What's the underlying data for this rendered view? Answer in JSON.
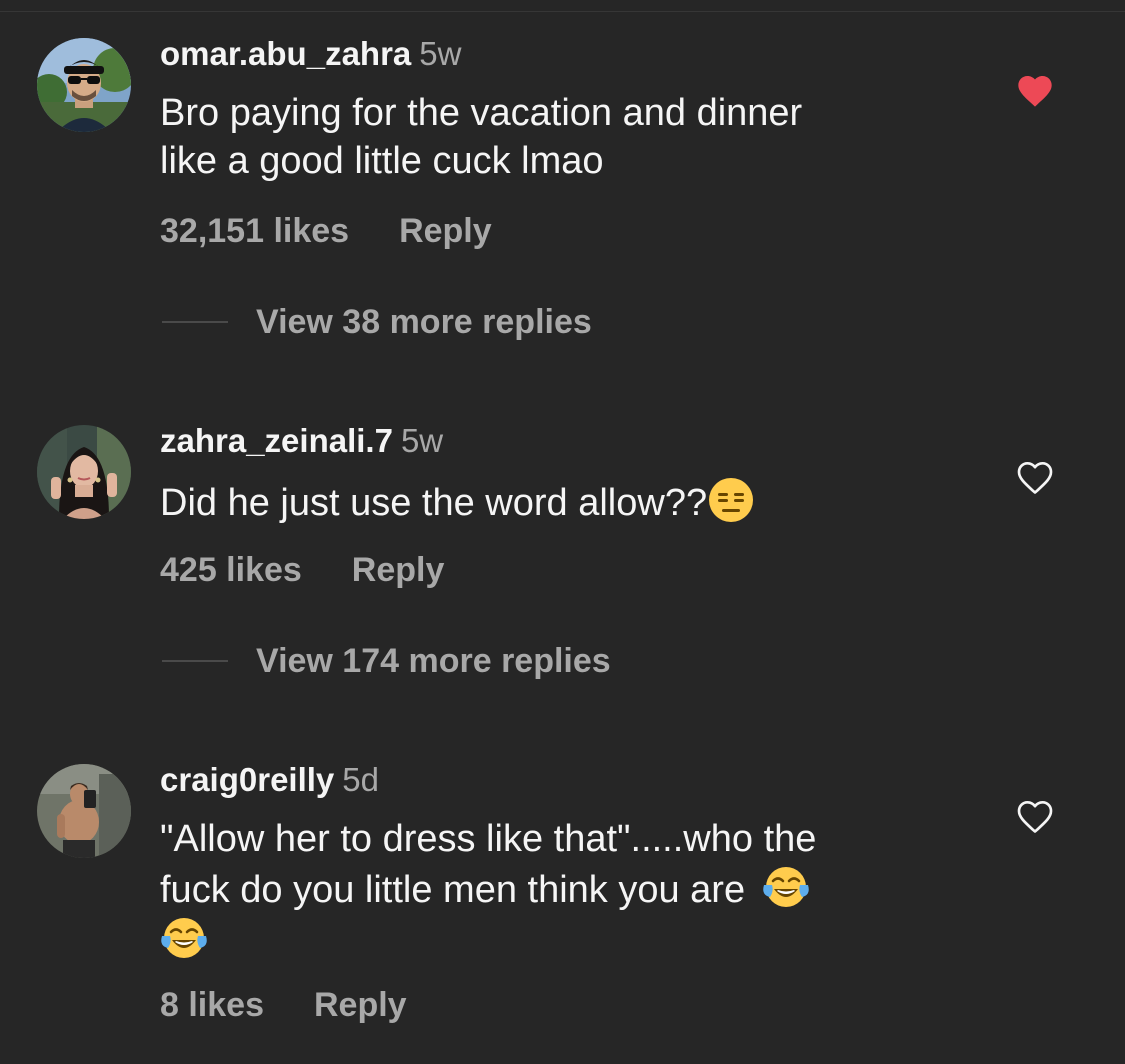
{
  "colors": {
    "background": "#262626",
    "text_primary": "#f5f5f5",
    "text_secondary": "#a8a8a8",
    "liked_heart": "#ed4956"
  },
  "comments": [
    {
      "username": "omar.abu_zahra",
      "time": "5w",
      "text_lines": [
        "Bro paying for the vacation and dinner",
        "like a good little cuck lmao"
      ],
      "emojis": [],
      "likes": "32,151 likes",
      "reply_label": "Reply",
      "view_replies": "View 38 more replies",
      "liked": true,
      "heart_icon": "heart-filled-icon"
    },
    {
      "username": "zahra_zeinali.7",
      "time": "5w",
      "text_lines": [
        "Did he just use the word allow??"
      ],
      "emojis": [
        "expressionless-face"
      ],
      "likes": "425 likes",
      "reply_label": "Reply",
      "view_replies": "View 174 more replies",
      "liked": false,
      "heart_icon": "heart-outline-icon"
    },
    {
      "username": "craig0reilly",
      "time": "5d",
      "text_lines": [
        "\"Allow her to dress like that\".....who the",
        "fuck do you little men think you are"
      ],
      "emojis": [
        "face-with-tears-of-joy",
        "face-with-tears-of-joy"
      ],
      "likes": "8 likes",
      "reply_label": "Reply",
      "liked": false,
      "heart_icon": "heart-outline-icon"
    }
  ]
}
